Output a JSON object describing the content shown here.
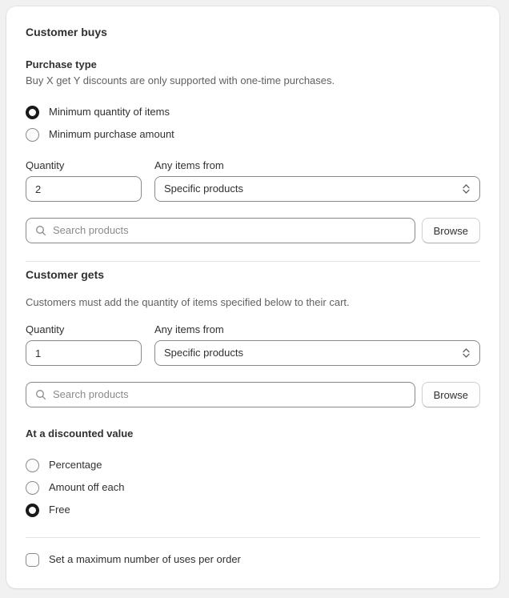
{
  "card": {
    "buys": {
      "title": "Customer buys",
      "purchase_type": {
        "label": "Purchase type",
        "help": "Buy X get Y discounts are only supported with one-time purchases.",
        "options": [
          {
            "label": "Minimum quantity of items",
            "selected": true
          },
          {
            "label": "Minimum purchase amount",
            "selected": false
          }
        ]
      },
      "quantity": {
        "label": "Quantity",
        "value": "2"
      },
      "source": {
        "label": "Any items from",
        "value": "Specific products"
      },
      "search": {
        "placeholder": "Search products",
        "value": "",
        "browse_label": "Browse"
      }
    },
    "gets": {
      "title": "Customer gets",
      "description": "Customers must add the quantity of items specified below to their cart.",
      "quantity": {
        "label": "Quantity",
        "value": "1"
      },
      "source": {
        "label": "Any items from",
        "value": "Specific products"
      },
      "search": {
        "placeholder": "Search products",
        "value": "",
        "browse_label": "Browse"
      },
      "discount": {
        "heading": "At a discounted value",
        "options": [
          {
            "label": "Percentage",
            "selected": false
          },
          {
            "label": "Amount off each",
            "selected": false
          },
          {
            "label": "Free",
            "selected": true
          }
        ]
      }
    },
    "max_uses": {
      "label": "Set a maximum number of uses per order",
      "checked": false
    }
  },
  "colors": {
    "page_bg": "#f1f1f1",
    "card_bg": "#ffffff",
    "text_primary": "#303030",
    "text_secondary": "#616161",
    "border": "#8a8a8a",
    "divider": "#e3e3e3",
    "selected": "#1a1a1a"
  }
}
